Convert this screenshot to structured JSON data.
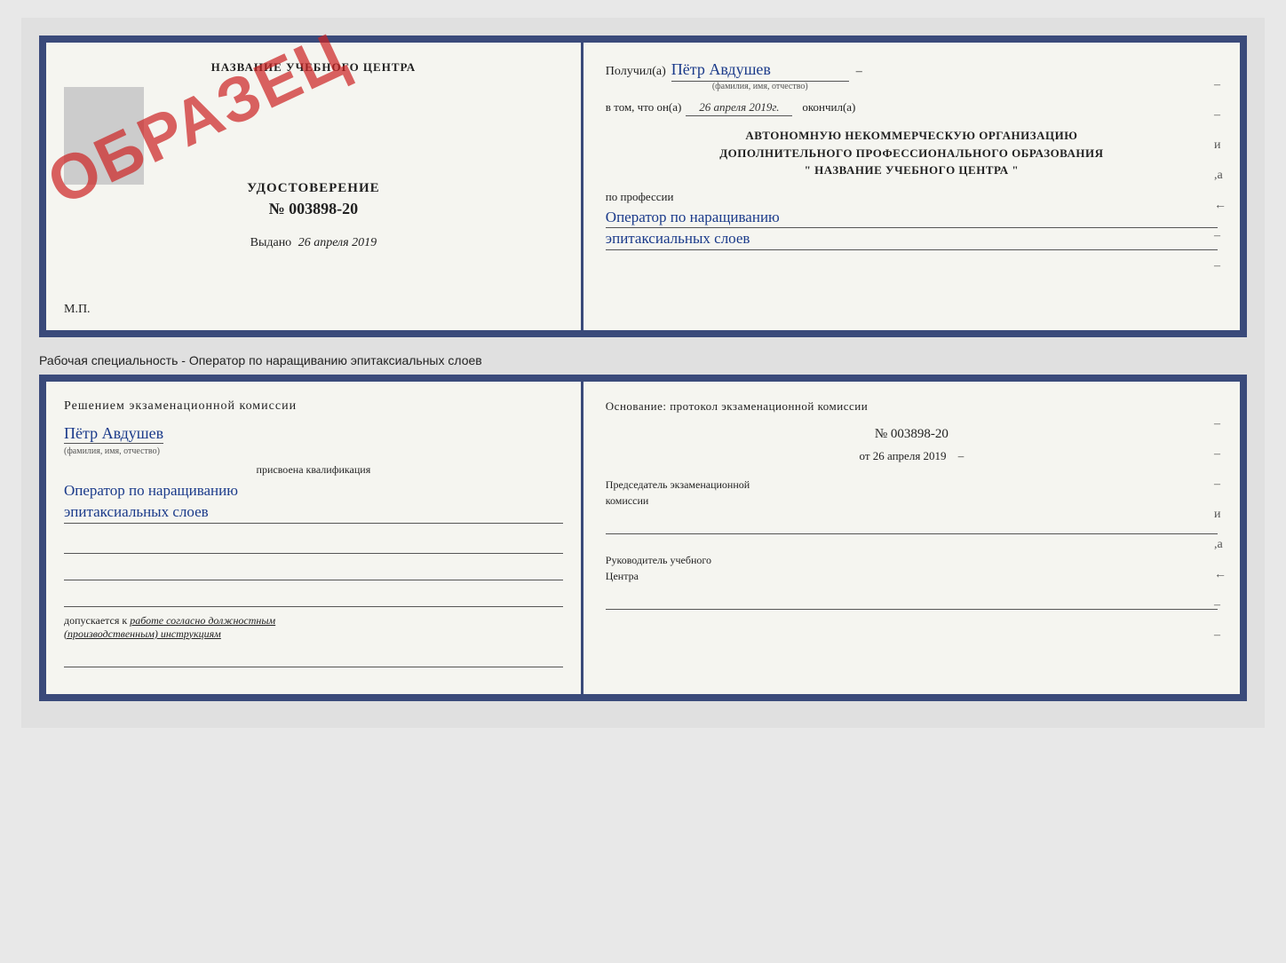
{
  "page": {
    "background_color": "#e0e0e0"
  },
  "doc1": {
    "left": {
      "center_name": "НАЗВАНИЕ УЧЕБНОГО ЦЕНТРА",
      "obrazec": "ОБРАЗЕЦ",
      "udostoverenie_label": "УДОСТОВЕРЕНИЕ",
      "udostoverenie_number": "№ 003898-20",
      "vydano_label": "Выдано",
      "vydano_date": "26 апреля 2019",
      "mp_label": "М.П."
    },
    "right": {
      "poluchil_label": "Получил(а)",
      "poluchil_name": "Пётр Авдушев",
      "poluchil_hint": "(фамилия, имя, отчество)",
      "vtom_label": "в том, что он(а)",
      "vtom_date": "26 апреля 2019г.",
      "okonchil_label": "окончил(а)",
      "org_line1": "АВТОНОМНУЮ НЕКОММЕРЧЕСКУЮ ОРГАНИЗАЦИЮ",
      "org_line2": "ДОПОЛНИТЕЛЬНОГО ПРОФЕССИОНАЛЬНОГО ОБРАЗОВАНИЯ",
      "org_line3": "\"   НАЗВАНИЕ УЧЕБНОГО ЦЕНТРА   \"",
      "profession_label": "по профессии",
      "profession_value": "Оператор по наращиванию",
      "profession_value2": "эпитаксиальных слоев"
    }
  },
  "separator": {
    "text": "Рабочая специальность - Оператор по наращиванию эпитаксиальных слоев"
  },
  "doc2": {
    "left": {
      "resheniem_label": "Решением экзаменационной комиссии",
      "name_value": "Пётр Авдушев",
      "name_hint": "(фамилия, имя, отчество)",
      "prisvoena_label": "присвоена квалификация",
      "kvalifikacia_line1": "Оператор по наращиванию",
      "kvalifikacia_line2": "эпитаксиальных слоев",
      "dopuskaetsya_prefix": "допускается к",
      "dopuskaetsya_italic": "работе согласно должностным",
      "dopuskaetsya_italic2": "(производственным) инструкциям"
    },
    "right": {
      "osnovanie_label": "Основание: протокол экзаменационной комиссии",
      "protocol_number": "№  003898-20",
      "ot_label": "от",
      "ot_date": "26 апреля 2019",
      "predsedatel_line1": "Председатель экзаменационной",
      "predsedatel_line2": "комиссии",
      "rukovoditel_line1": "Руководитель учебного",
      "rukovoditel_line2": "Центра"
    }
  }
}
